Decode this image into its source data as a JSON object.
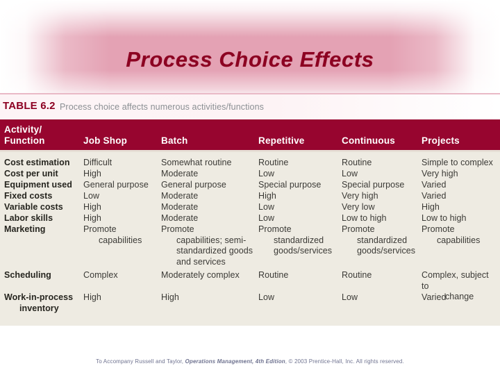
{
  "slide": {
    "title": "Process Choice Effects",
    "title_color": "#8c0021",
    "banner_color": "#e4a2b4"
  },
  "table": {
    "number": "TABLE 6.2",
    "caption": "Process choice affects numerous activities/functions",
    "header_bg": "#97052f",
    "body_bg": "#eeebe2",
    "columns": [
      {
        "label_line1": "Activity/",
        "label_line2": "Function"
      },
      {
        "label_line1": "Job Shop",
        "label_line2": ""
      },
      {
        "label_line1": "Batch",
        "label_line2": ""
      },
      {
        "label_line1": "Repetitive",
        "label_line2": ""
      },
      {
        "label_line1": "Continuous",
        "label_line2": ""
      },
      {
        "label_line1": "Projects",
        "label_line2": ""
      }
    ],
    "rows": [
      {
        "label": "Cost estimation",
        "job_shop": "Difficult",
        "batch": "Somewhat routine",
        "repetitive": "Routine",
        "continuous": "Routine",
        "projects": "Simple to complex"
      },
      {
        "label": "Cost per unit",
        "job_shop": "High",
        "batch": "Moderate",
        "repetitive": "Low",
        "continuous": "Low",
        "projects": "Very high"
      },
      {
        "label": "Equipment used",
        "job_shop": "General purpose",
        "batch": "General purpose",
        "repetitive": "Special purpose",
        "continuous": "Special purpose",
        "projects": "Varied"
      },
      {
        "label": "Fixed costs",
        "job_shop": "Low",
        "batch": "Moderate",
        "repetitive": "High",
        "continuous": "Very high",
        "projects": "Varied"
      },
      {
        "label": "Variable costs",
        "job_shop": "High",
        "batch": "Moderate",
        "repetitive": "Low",
        "continuous": "Very low",
        "projects": "High"
      },
      {
        "label": "Labor skills",
        "job_shop": "High",
        "batch": "Moderate",
        "repetitive": "Low",
        "continuous": "Low to high",
        "projects": "Low to high"
      },
      {
        "label": "Marketing",
        "job_shop": "Promote",
        "job_shop_cont": "capabilities",
        "batch": "Promote",
        "batch_cont": "capabilities; semi-standardized goods and services",
        "repetitive": "Promote",
        "repetitive_cont": "standardized goods/services",
        "continuous": "Promote",
        "continuous_cont": "standardized goods/services",
        "projects": "Promote",
        "projects_cont": "capabilities"
      },
      {
        "label": "Scheduling",
        "job_shop": "Complex",
        "batch": "Moderately complex",
        "repetitive": "Routine",
        "continuous": "Routine",
        "projects": "Complex, subject to",
        "projects_cont": "change"
      },
      {
        "label": "Work-in-process",
        "label_cont": "inventory",
        "job_shop": "High",
        "batch": "High",
        "repetitive": "Low",
        "continuous": "Low",
        "projects": "Varied"
      }
    ]
  },
  "footer": {
    "prefix": "To Accompany Russell and Taylor, ",
    "italic": "Operations Management, 4th Edition",
    "suffix": ", © 2003 Prentice-Hall, Inc. All rights reserved."
  }
}
